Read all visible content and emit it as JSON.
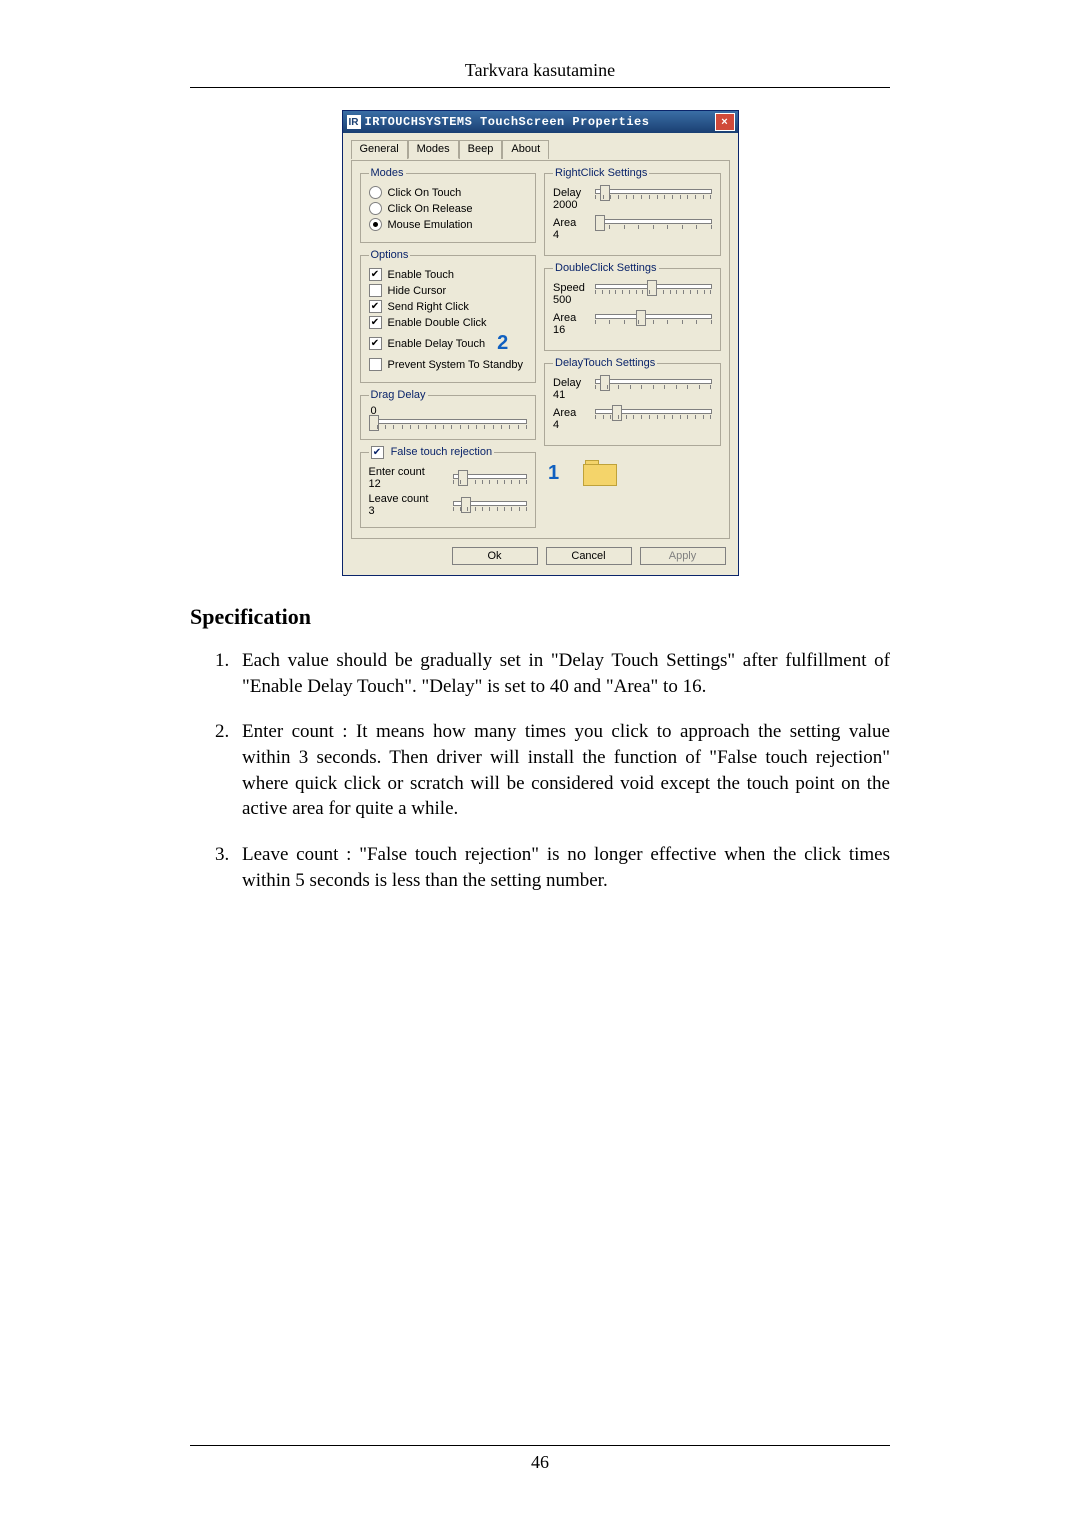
{
  "doc": {
    "header": "Tarkvara kasutamine",
    "spec_title": "Specification",
    "items": [
      "Each value should be gradually set in \"Delay Touch Settings\" after fulfillment of \"Enable Delay Touch\". \"Delay\" is set to 40 and \"Area\" to 16.",
      "Enter count : It means how many times you click to approach the setting value within 3 seconds. Then driver will install the function of \"False touch rejection\" where quick click or scratch will be considered void except the touch point on the active area for quite a while.",
      "Leave count : \"False touch rejection\" is no longer effective when the click times within 5 seconds is less than the setting number."
    ],
    "page_number": "46"
  },
  "dialog": {
    "icon_letters": "IR",
    "title": "IRTOUCHSYSTEMS TouchScreen Properties",
    "tabs": [
      "General",
      "Modes",
      "Beep",
      "About"
    ],
    "active_tab": "Modes",
    "modes_group": {
      "legend": "Modes",
      "radios": [
        {
          "label": "Click On Touch",
          "selected": false
        },
        {
          "label": "Click On Release",
          "selected": false
        },
        {
          "label": "Mouse Emulation",
          "selected": true
        }
      ]
    },
    "options_group": {
      "legend": "Options",
      "checks": [
        {
          "label": "Enable Touch",
          "checked": true
        },
        {
          "label": "Hide Cursor",
          "checked": false
        },
        {
          "label": "Send Right Click",
          "checked": true
        },
        {
          "label": "Enable Double Click",
          "checked": true
        },
        {
          "label": "Enable Delay Touch",
          "checked": true
        },
        {
          "label": "Prevent System To Standby",
          "checked": false
        }
      ]
    },
    "drag_delay": {
      "legend": "Drag Delay",
      "value": "0"
    },
    "false_touch": {
      "legend_checked": true,
      "legend_label": "False touch rejection",
      "enter_label": "Enter count",
      "enter_value": "12",
      "leave_label": "Leave count",
      "leave_value": "3"
    },
    "rightclick": {
      "legend": "RightClick Settings",
      "delay_label": "Delay",
      "delay_value": "2000",
      "area_label": "Area",
      "area_value": "4"
    },
    "doubleclick": {
      "legend": "DoubleClick Settings",
      "speed_label": "Speed",
      "speed_value": "500",
      "area_label": "Area",
      "area_value": "16"
    },
    "delaytouch": {
      "legend": "DelayTouch Settings",
      "delay_label": "Delay",
      "delay_value": "41",
      "area_label": "Area",
      "area_value": "4"
    },
    "callouts": {
      "one": "1",
      "two": "2"
    },
    "buttons": {
      "ok": "Ok",
      "cancel": "Cancel",
      "apply": "Apply"
    }
  }
}
